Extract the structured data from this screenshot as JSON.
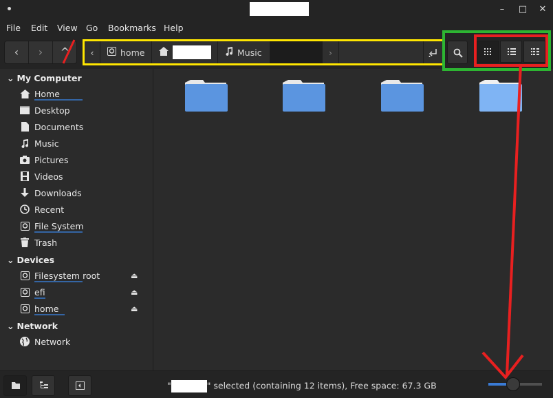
{
  "window": {
    "close_icon": "✕",
    "maximize_icon": "□",
    "minimize_icon": "–"
  },
  "menu": [
    "File",
    "Edit",
    "View",
    "Go",
    "Bookmarks",
    "Help"
  ],
  "toolbar": {
    "back_icon": "‹",
    "forward_icon": "›",
    "up_icon": "^"
  },
  "pathbar": {
    "left_arrow": "‹",
    "right_arrow": "›",
    "crumbs": [
      {
        "label": "home",
        "icon": "drive-icon"
      },
      {
        "label": "",
        "icon": "home-icon"
      },
      {
        "label": "Music",
        "icon": "music-icon"
      }
    ]
  },
  "sidebar": {
    "my_computer": "My Computer",
    "devices": "Devices",
    "network": "Network",
    "items_computer": [
      "Home",
      "Desktop",
      "Documents",
      "Music",
      "Pictures",
      "Videos",
      "Downloads",
      "Recent",
      "File System",
      "Trash"
    ],
    "items_devices": [
      "Filesystem root",
      "efi",
      "home"
    ],
    "items_network": [
      "Network"
    ]
  },
  "status": {
    "prefix": "\"",
    "suffix": "\" selected (containing 12 items), Free space: 67.3 GB"
  },
  "zoom_level": 0.45,
  "colors": {
    "accent": "#3465a4",
    "folder": "#5b95e0",
    "annotation_yellow": "#ffe600",
    "annotation_green": "#2db532",
    "annotation_red": "#e82020"
  }
}
